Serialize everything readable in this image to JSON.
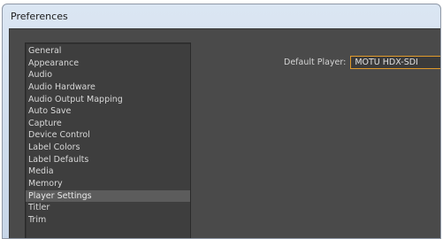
{
  "window": {
    "title": "Preferences"
  },
  "sidebar": {
    "items": [
      {
        "label": "General",
        "selected": false
      },
      {
        "label": "Appearance",
        "selected": false
      },
      {
        "label": "Audio",
        "selected": false
      },
      {
        "label": "Audio Hardware",
        "selected": false
      },
      {
        "label": "Audio Output Mapping",
        "selected": false
      },
      {
        "label": "Auto Save",
        "selected": false
      },
      {
        "label": "Capture",
        "selected": false
      },
      {
        "label": "Device Control",
        "selected": false
      },
      {
        "label": "Label Colors",
        "selected": false
      },
      {
        "label": "Label Defaults",
        "selected": false
      },
      {
        "label": "Media",
        "selected": false
      },
      {
        "label": "Memory",
        "selected": false
      },
      {
        "label": "Player Settings",
        "selected": true
      },
      {
        "label": "Titler",
        "selected": false
      },
      {
        "label": "Trim",
        "selected": false
      }
    ]
  },
  "player_settings": {
    "default_player_label": "Default Player:",
    "default_player_value": "MOTU HDX-SDI"
  },
  "colors": {
    "panel_background": "#4a4a4a",
    "list_background": "#3e3e3e",
    "selection": "#5c5c5c",
    "focus_accent": "#e09a2b",
    "titlebar": "#d3e0ef"
  }
}
